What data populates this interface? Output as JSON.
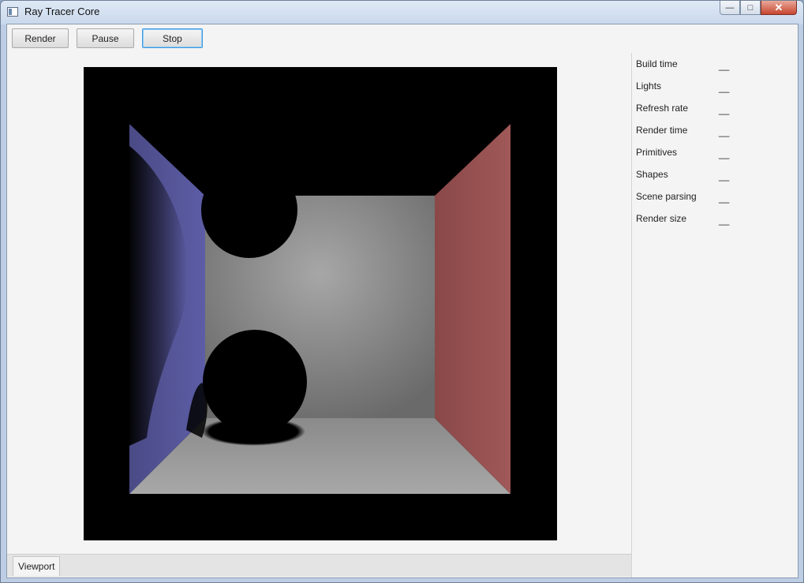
{
  "window": {
    "title": "Ray Tracer Core",
    "controls": {
      "minimize": "—",
      "maximize": "□",
      "close": "✕"
    }
  },
  "toolbar": {
    "render_label": "Render",
    "pause_label": "Pause",
    "stop_label": "Stop"
  },
  "tabs": [
    {
      "label": "Viewport"
    }
  ],
  "stats": [
    {
      "label": "Build time",
      "value": "__"
    },
    {
      "label": "Lights",
      "value": "__"
    },
    {
      "label": "Refresh rate",
      "value": "__"
    },
    {
      "label": "Render time",
      "value": "__"
    },
    {
      "label": "Primitives",
      "value": "__"
    },
    {
      "label": "Shapes",
      "value": "__"
    },
    {
      "label": "Scene parsing",
      "value": "__"
    },
    {
      "label": "Render size",
      "value": "__"
    }
  ]
}
